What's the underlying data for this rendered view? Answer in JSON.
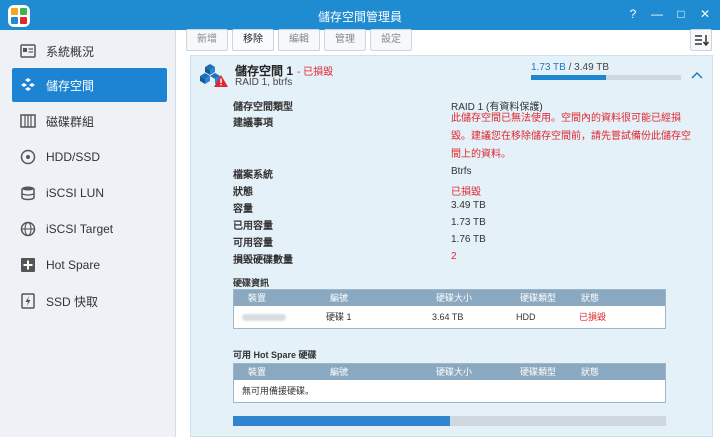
{
  "window": {
    "title": "儲存空間管理員",
    "controls": [
      "?",
      "—",
      "□",
      "✕"
    ]
  },
  "sidebar": {
    "items": [
      {
        "label": "系統概況",
        "icon": "overview-icon",
        "active": false
      },
      {
        "label": "儲存空間",
        "icon": "storage-pool-icon",
        "active": true
      },
      {
        "label": "磁碟群組",
        "icon": "disk-group-icon",
        "active": false
      },
      {
        "label": "HDD/SSD",
        "icon": "hdd-icon",
        "active": false
      },
      {
        "label": "iSCSI LUN",
        "icon": "iscsi-lun-icon",
        "active": false
      },
      {
        "label": "iSCSI Target",
        "icon": "iscsi-target-icon",
        "active": false
      },
      {
        "label": "Hot Spare",
        "icon": "hot-spare-icon",
        "active": false
      },
      {
        "label": "SSD 快取",
        "icon": "ssd-cache-icon",
        "active": false
      }
    ]
  },
  "toolbar": {
    "buttons": [
      {
        "label": "新增",
        "enabled": false
      },
      {
        "label": "移除",
        "enabled": true
      },
      {
        "label": "編輯",
        "enabled": false
      },
      {
        "label": "管理",
        "enabled": false
      },
      {
        "label": "設定",
        "enabled": false
      }
    ]
  },
  "volume": {
    "name": "儲存空間 1",
    "state": "- 已損毀",
    "subtitle": "RAID 1, btrfs",
    "used": "1.73 TB",
    "total": "/ 3.49 TB",
    "usage_fraction": 0.5,
    "properties": [
      {
        "label": "儲存空間類型",
        "value": "RAID 1 (有資料保護)",
        "red": false
      },
      {
        "label": "建議事項",
        "value": "",
        "red": true
      },
      {
        "label": "檔案系統",
        "value": "Btrfs",
        "red": false
      },
      {
        "label": "狀態",
        "value": "已損毀",
        "red": true
      },
      {
        "label": "容量",
        "value": "3.49 TB",
        "red": false
      },
      {
        "label": "已用容量",
        "value": "1.73 TB",
        "red": false
      },
      {
        "label": "可用容量",
        "value": "1.76 TB",
        "red": false
      },
      {
        "label": "損毀硬碟數量",
        "value": "2",
        "red": true
      }
    ],
    "suggestion_lines": [
      "此儲存空間已無法使用。空間內的資料很可能已經損",
      "毀。建議您在移除儲存空間前，請先嘗試備份此儲存空",
      "間上的資料。"
    ]
  },
  "disk_info": {
    "title": "硬碟資訊",
    "columns": [
      "裝置",
      "編號",
      "硬碟大小",
      "硬碟類型",
      "狀態"
    ],
    "rows": [
      {
        "device": "",
        "number": "硬碟 1",
        "size": "3.64 TB",
        "type": "HDD",
        "status": "已損毀"
      }
    ]
  },
  "hot_spare": {
    "title": "可用 Hot Spare 硬碟",
    "columns": [
      "裝置",
      "編號",
      "硬碟大小",
      "硬碟類型",
      "狀態"
    ],
    "empty_text": "無可用備援硬碟。"
  },
  "bottom_progress_fraction": 0.5,
  "colors": {
    "titlebar": "#1f8bd1",
    "accent": "#1d84d4",
    "error": "#e0262e",
    "panel": "#e5f1f8"
  }
}
